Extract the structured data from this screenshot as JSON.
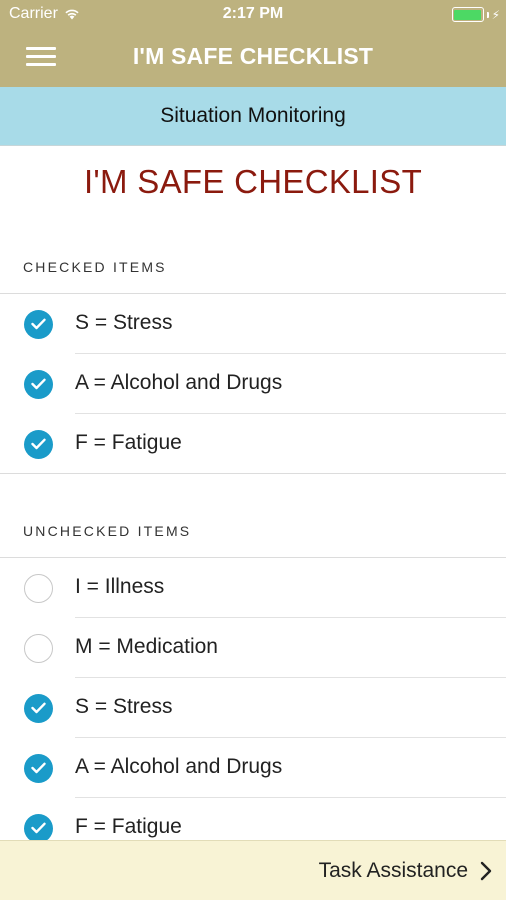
{
  "status_bar": {
    "carrier": "Carrier",
    "time": "2:17 PM",
    "battery_color": "#4cd964"
  },
  "nav": {
    "title": "I'M SAFE CHECKLIST",
    "menu_icon": "hamburger-menu-icon",
    "background": "#bdb27f"
  },
  "subheader": {
    "title": "Situation Monitoring",
    "background": "#a8dbe8"
  },
  "page": {
    "title": "I'M SAFE CHECKLIST",
    "title_color": "#8b1a0e"
  },
  "checked_section": {
    "header": "CHECKED ITEMS",
    "items": [
      {
        "label": "S = Stress",
        "checked": true
      },
      {
        "label": "A = Alcohol and Drugs",
        "checked": true
      },
      {
        "label": "F = Fatigue",
        "checked": true
      }
    ]
  },
  "unchecked_section": {
    "header": "UNCHECKED ITEMS",
    "items": [
      {
        "label": "I = Illness",
        "checked": false
      },
      {
        "label": "M = Medication",
        "checked": false
      },
      {
        "label": "S = Stress",
        "checked": true
      },
      {
        "label": "A = Alcohol and Drugs",
        "checked": true
      },
      {
        "label": "F = Fatigue",
        "checked": true
      }
    ]
  },
  "footer": {
    "label": "Task Assistance",
    "icon": "chevron-right-icon"
  },
  "colors": {
    "check_accent": "#1a9bc9",
    "footer_background": "#f8f3d5"
  }
}
